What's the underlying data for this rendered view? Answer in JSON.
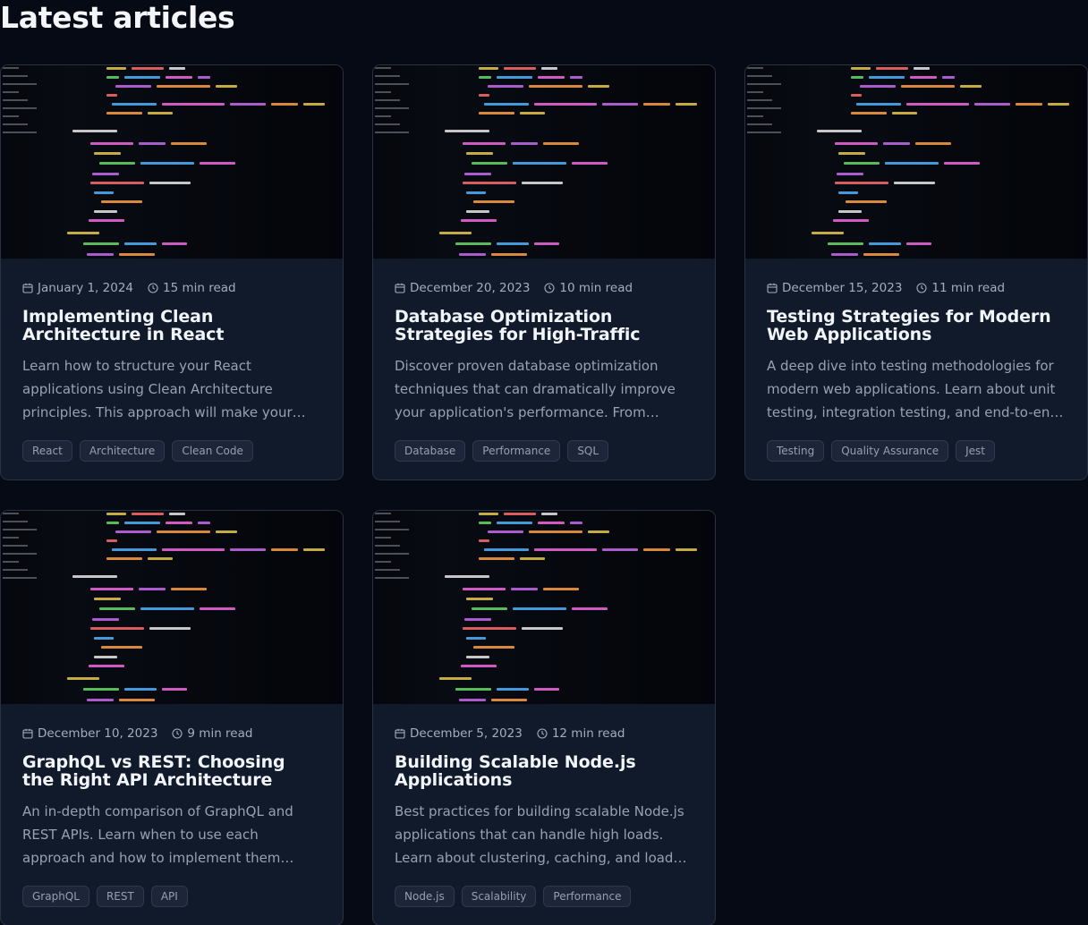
{
  "section": {
    "title": "Latest articles"
  },
  "colors": {
    "background": "#050a14",
    "card": "#111a2a",
    "card_border": "#273244",
    "tag_bg": "#1c2638",
    "meta_text": "#a3adbd"
  },
  "icons": {
    "date": "calendar-icon",
    "read_time": "clock-icon",
    "thumbnail": "code-editor-screenshot"
  },
  "articles": [
    {
      "date": "January 1, 2024",
      "read_time": "15 min read",
      "title": "Implementing Clean Architecture in React Applications",
      "excerpt": "Learn how to structure your React applications using Clean Architecture principles. This approach will make your code more maintainable.",
      "tags": [
        "React",
        "Architecture",
        "Clean Code"
      ]
    },
    {
      "date": "December 20, 2023",
      "read_time": "10 min read",
      "title": "Database Optimization Strategies for High-Traffic Applications",
      "excerpt": "Discover proven database optimization techniques that can dramatically improve your application's performance. From indexing to caching.",
      "tags": [
        "Database",
        "Performance",
        "SQL"
      ]
    },
    {
      "date": "December 15, 2023",
      "read_time": "11 min read",
      "title": "Testing Strategies for Modern Web Applications",
      "excerpt": "A deep dive into testing methodologies for modern web applications. Learn about unit testing, integration testing, and end-to-end testing.",
      "tags": [
        "Testing",
        "Quality Assurance",
        "Jest"
      ]
    },
    {
      "date": "December 10, 2023",
      "read_time": "9 min read",
      "title": "GraphQL vs REST: Choosing the Right API Architecture",
      "excerpt": "An in-depth comparison of GraphQL and REST APIs. Learn when to use each approach and how to implement them effectively in your projects.",
      "tags": [
        "GraphQL",
        "REST",
        "API"
      ]
    },
    {
      "date": "December 5, 2023",
      "read_time": "12 min read",
      "title": "Building Scalable Node.js Applications",
      "excerpt": "Best practices for building scalable Node.js applications that can handle high loads. Learn about clustering, caching, and load balancing.",
      "tags": [
        "Node.js",
        "Scalability",
        "Performance"
      ]
    }
  ]
}
